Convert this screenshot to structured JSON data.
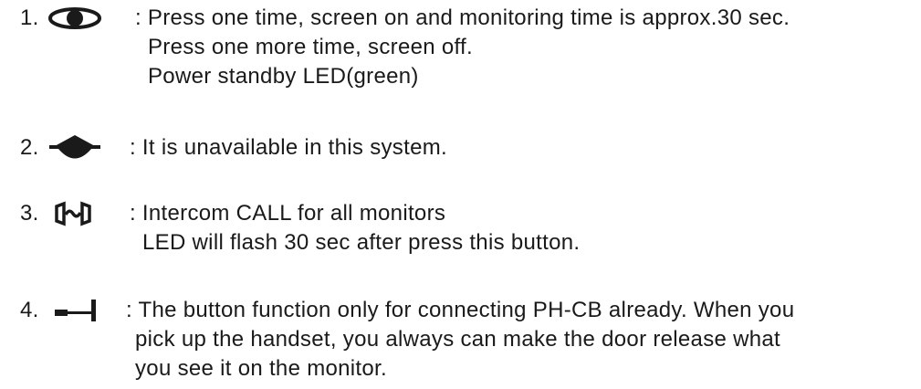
{
  "items": [
    {
      "number": "1.",
      "icon": "eye-icon",
      "lines": [
        ": Press one time, screen on and monitoring time is approx.30 sec.",
        "Press one more time, screen off.",
        "Power standby LED(green)"
      ]
    },
    {
      "number": "2.",
      "icon": "speaker-icon",
      "lines": [
        ": It is unavailable in this system."
      ]
    },
    {
      "number": "3.",
      "icon": "intercom-icon",
      "lines": [
        ": Intercom CALL for all monitors",
        "LED will flash 30 sec after press this button."
      ]
    },
    {
      "number": "4.",
      "icon": "key-icon",
      "lines": [
        ": The button function only for connecting PH-CB already. When you",
        "pick up the handset, you always can make the door release what",
        "you see it on the monitor."
      ]
    }
  ]
}
